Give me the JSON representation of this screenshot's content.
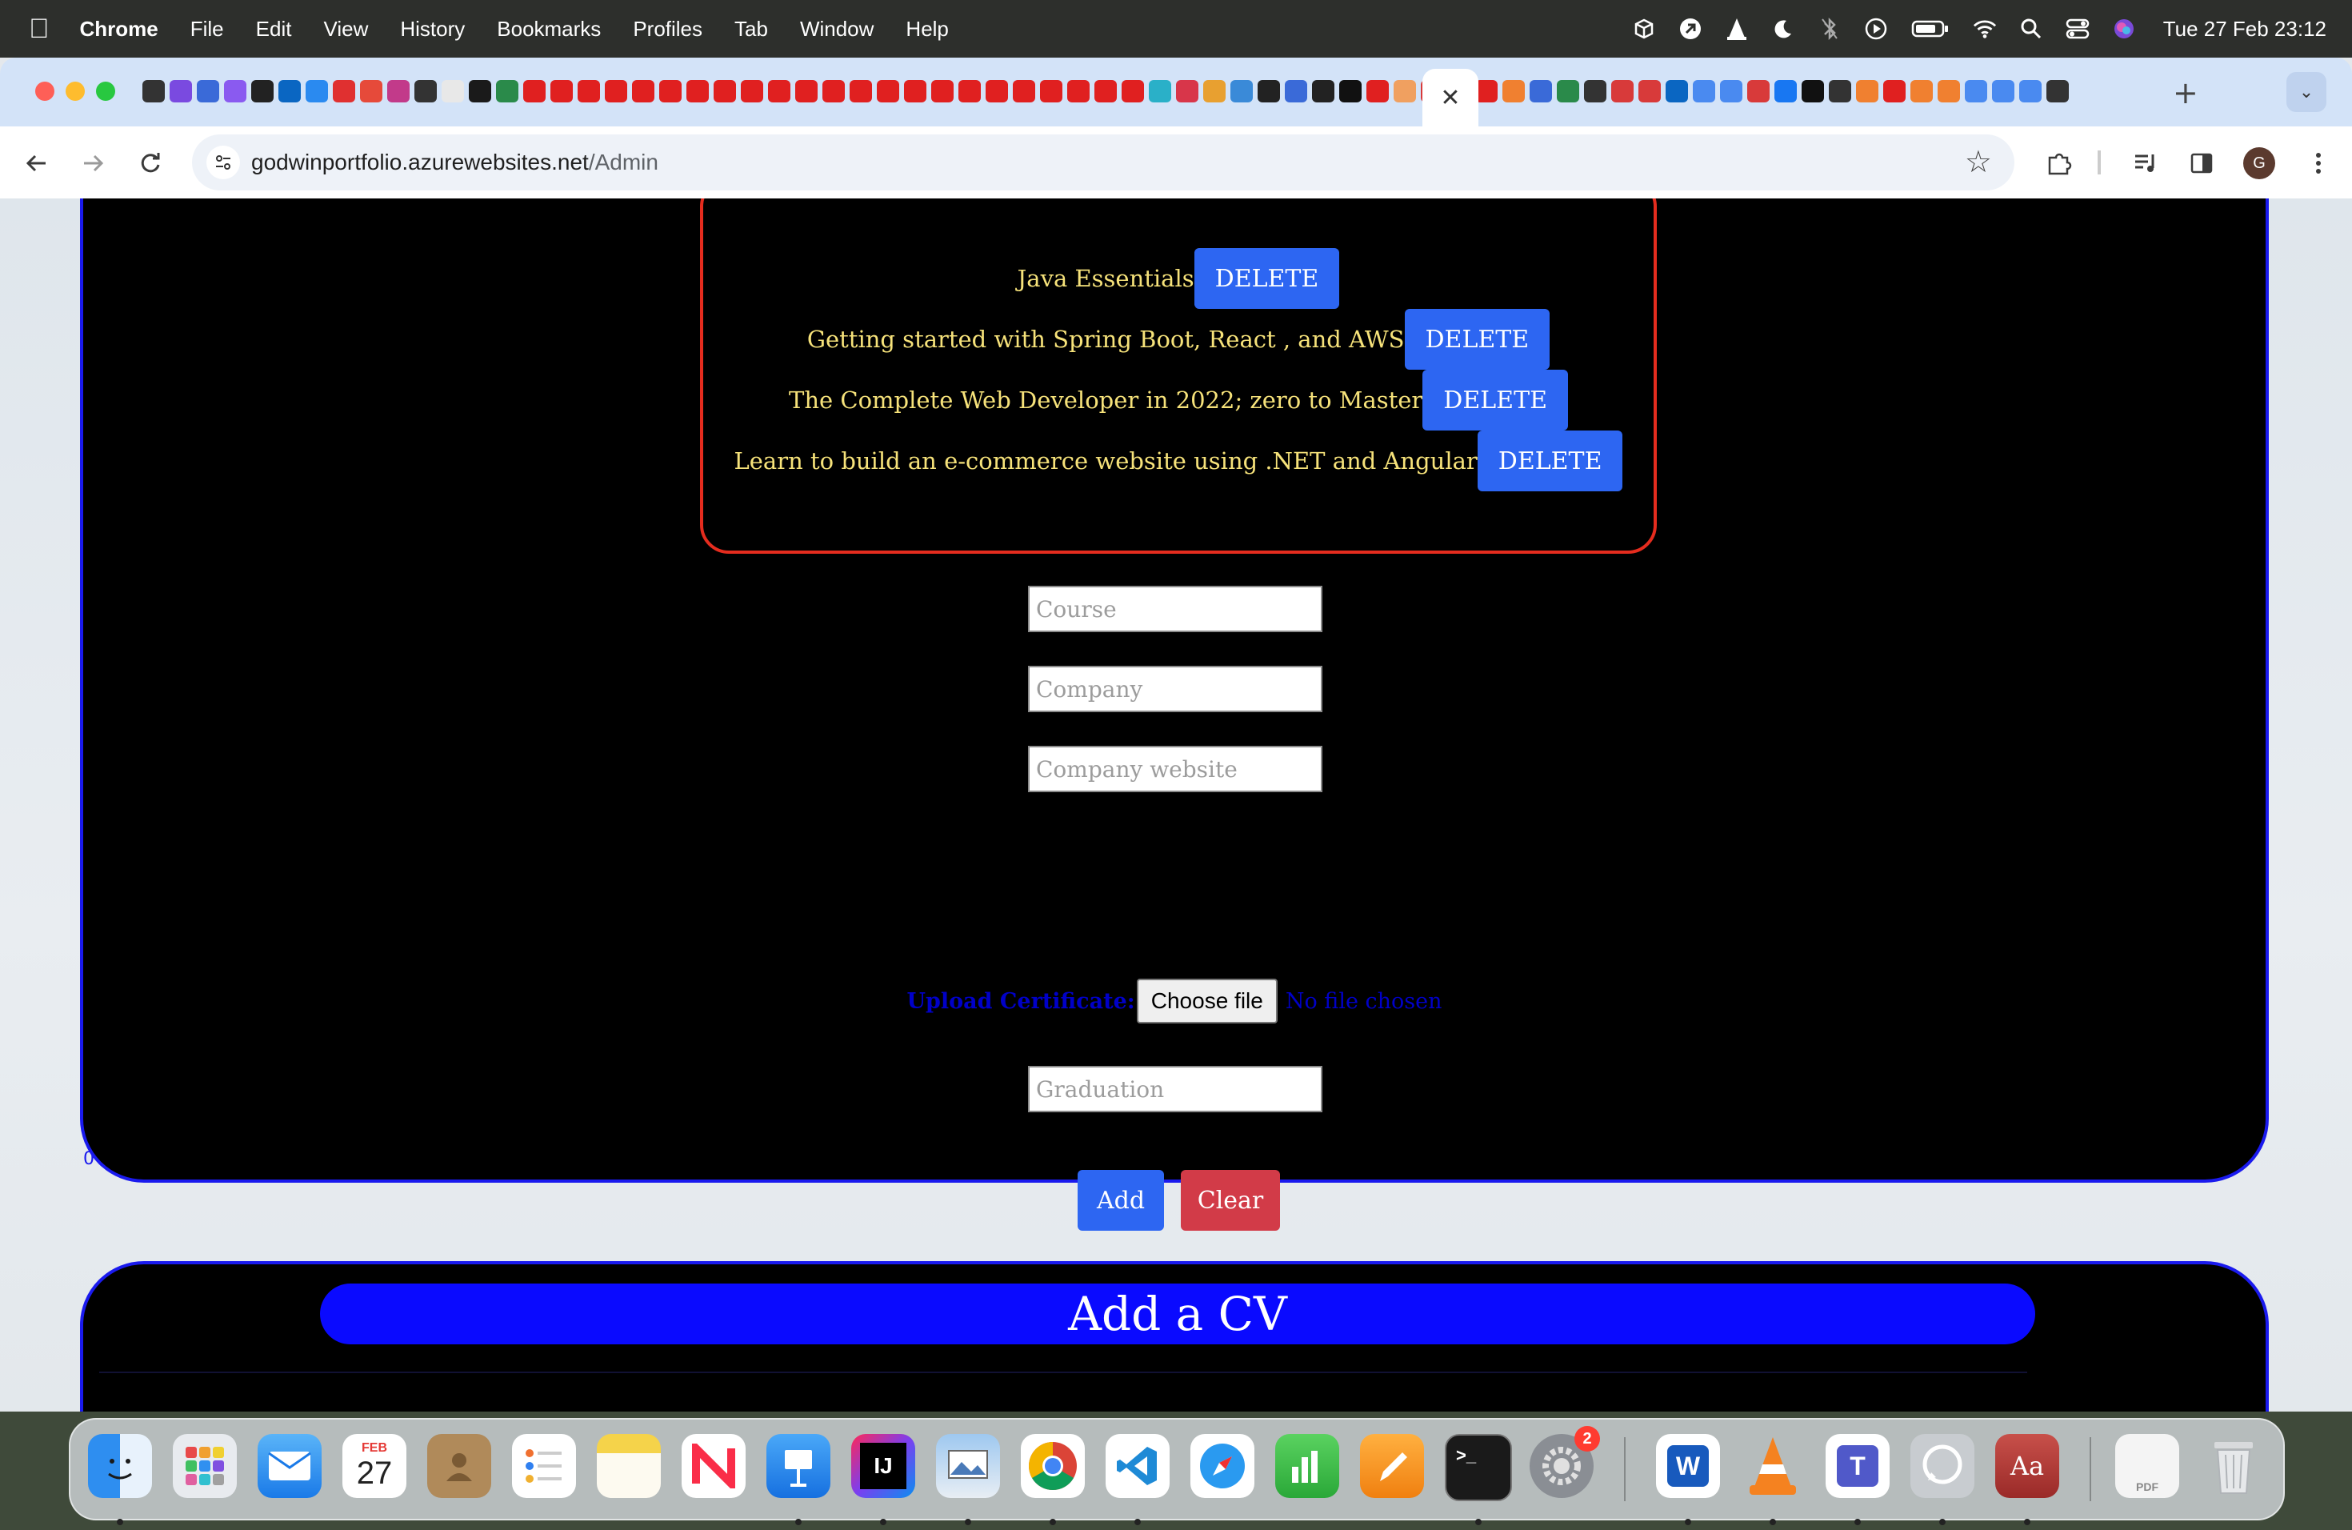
{
  "menubar": {
    "app": "Chrome",
    "items": [
      "File",
      "Edit",
      "View",
      "History",
      "Bookmarks",
      "Profiles",
      "Tab",
      "Window",
      "Help"
    ],
    "clock": "Tue 27 Feb  23:12"
  },
  "browser": {
    "url_host": "godwinportfolio.azurewebsites.net",
    "url_path": "/Admin",
    "profile_initial": "G",
    "close_tab": "✕",
    "new_tab": "+"
  },
  "courses": [
    {
      "name": "Java Essentials",
      "delete_label": "DELETE"
    },
    {
      "name": "Getting started with Spring Boot, React , and AWS",
      "delete_label": "DELETE"
    },
    {
      "name": "The Complete Web Developer in 2022; zero to Master",
      "delete_label": "DELETE"
    },
    {
      "name": "Learn to build an e-commerce website using .NET and Angular",
      "delete_label": "DELETE"
    }
  ],
  "form": {
    "course_placeholder": "Course",
    "company_placeholder": "Company",
    "website_placeholder": "Company website",
    "upload_label": "Upload Certificate:",
    "choose_file_label": "Choose file",
    "no_file_text": "No file chosen",
    "graduation_placeholder": "Graduation",
    "add_label": "Add",
    "clear_label": "Clear",
    "stray_mark": "0"
  },
  "cv_section": {
    "title": "Add a CV"
  },
  "dock": {
    "calendar_month": "FEB",
    "calendar_day": "27",
    "settings_badge": "2",
    "intellij_label": "IJ",
    "word_label": "W",
    "teams_label": "T",
    "dictionary_label": "Aa",
    "terminal_label": ">_",
    "pdf_label": "PDF"
  },
  "colors": {
    "card_border": "#1a1aee",
    "course_box_border": "#e52c1e",
    "course_text": "#f6e27a",
    "delete_button": "#2d66f2",
    "clear_button": "#d23b48",
    "cv_header": "#0a0aff"
  }
}
